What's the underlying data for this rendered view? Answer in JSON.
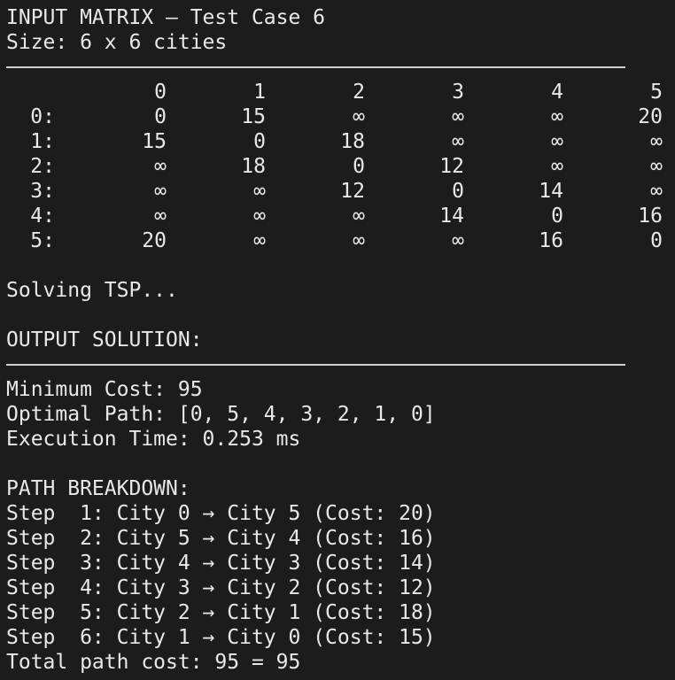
{
  "header": {
    "title": "INPUT MATRIX – Test Case 6",
    "size_line": "Size: 6 x 6 cities"
  },
  "matrix": {
    "columns": [
      "0",
      "1",
      "2",
      "3",
      "4",
      "5"
    ],
    "rows": [
      {
        "label": "0:",
        "cells": [
          "0",
          "15",
          "∞",
          "∞",
          "∞",
          "20"
        ]
      },
      {
        "label": "1:",
        "cells": [
          "15",
          "0",
          "18",
          "∞",
          "∞",
          "∞"
        ]
      },
      {
        "label": "2:",
        "cells": [
          "∞",
          "18",
          "0",
          "12",
          "∞",
          "∞"
        ]
      },
      {
        "label": "3:",
        "cells": [
          "∞",
          "∞",
          "12",
          "0",
          "14",
          "∞"
        ]
      },
      {
        "label": "4:",
        "cells": [
          "∞",
          "∞",
          "∞",
          "14",
          "0",
          "16"
        ]
      },
      {
        "label": "5:",
        "cells": [
          "20",
          "∞",
          "∞",
          "∞",
          "16",
          "0"
        ]
      }
    ]
  },
  "status": {
    "solving": "Solving TSP..."
  },
  "output": {
    "heading": "OUTPUT SOLUTION:",
    "min_cost": "Minimum Cost: 95",
    "optimal_path": "Optimal Path: [0, 5, 4, 3, 2, 1, 0]",
    "exec_time": "Execution Time: 0.253 ms"
  },
  "breakdown": {
    "heading": "PATH BREAKDOWN:",
    "steps": [
      "Step  1: City 0 → City 5 (Cost: 20)",
      "Step  2: City 5 → City 4 (Cost: 16)",
      "Step  3: City 4 → City 3 (Cost: 14)",
      "Step  4: City 3 → City 2 (Cost: 12)",
      "Step  5: City 2 → City 1 (Cost: 18)",
      "Step  6: City 1 → City 0 (Cost: 15)"
    ],
    "total": "Total path cost: 95 = 95"
  },
  "colors": {
    "background": "#1c1c1c",
    "text": "#e8e8e8",
    "rule": "#cfcfcf"
  }
}
